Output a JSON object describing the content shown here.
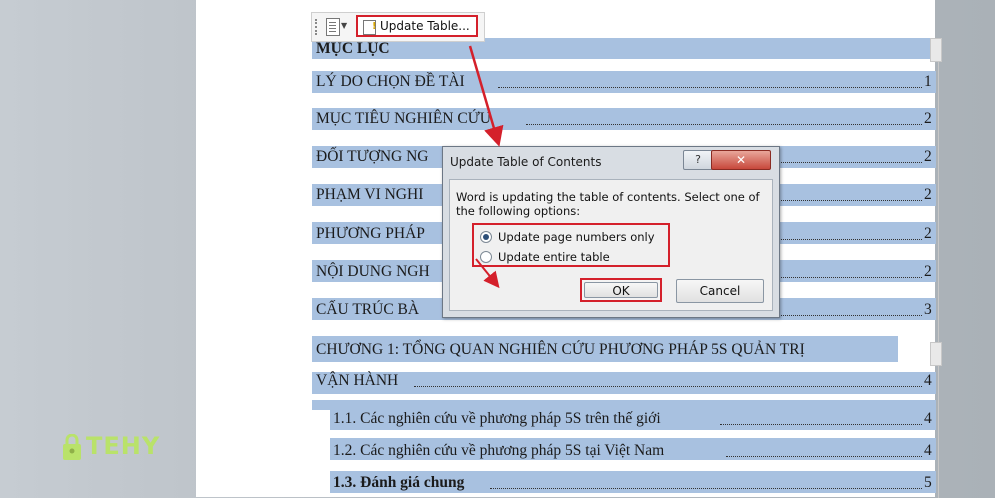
{
  "toolbar": {
    "update_label": "Update Table..."
  },
  "toc": {
    "heading": "MỤC LỤC",
    "entries": [
      {
        "text": "LÝ DO CHỌN ĐỀ TÀI",
        "page": "1"
      },
      {
        "text": "MỤC TIÊU NGHIÊN CỨU",
        "page": "2"
      },
      {
        "text": "ĐỐI TƯỢNG NG",
        "page": "2"
      },
      {
        "text": "PHẠM VI NGHI",
        "page": "2"
      },
      {
        "text": "PHƯƠNG PHÁP",
        "page": "2"
      },
      {
        "text": "NỘI DUNG NGH",
        "page": "2"
      },
      {
        "text": "CẤU TRÚC BÀ",
        "page": "3"
      },
      {
        "text": "CHƯƠNG 1: TỔNG QUAN NGHIÊN CỨU PHƯƠNG PHÁP 5S QUẢN TRỊ",
        "page": ""
      },
      {
        "text": "VẬN HÀNH",
        "page": "4"
      },
      {
        "text": "1.1. Các nghiên cứu về phương pháp 5S trên thế giới",
        "page": "4"
      },
      {
        "text": "1.2. Các nghiên cứu về phương pháp 5S tại Việt Nam",
        "page": "4"
      },
      {
        "text": "1.3. Đánh giá chung",
        "page": "5"
      }
    ]
  },
  "dialog": {
    "title": "Update Table of Contents",
    "help": "?",
    "close": "✕",
    "message": "Word is updating the table of contents.  Select one of the following options:",
    "options": [
      {
        "label": "Update page numbers only",
        "selected": true
      },
      {
        "label": "Update entire table",
        "selected": false
      }
    ],
    "ok": "OK",
    "cancel": "Cancel"
  },
  "logo": {
    "text": "TEHY"
  },
  "colors": {
    "highlight": "#d4202b",
    "selection": "#a8c1e0",
    "logo": "#b9e26a"
  }
}
